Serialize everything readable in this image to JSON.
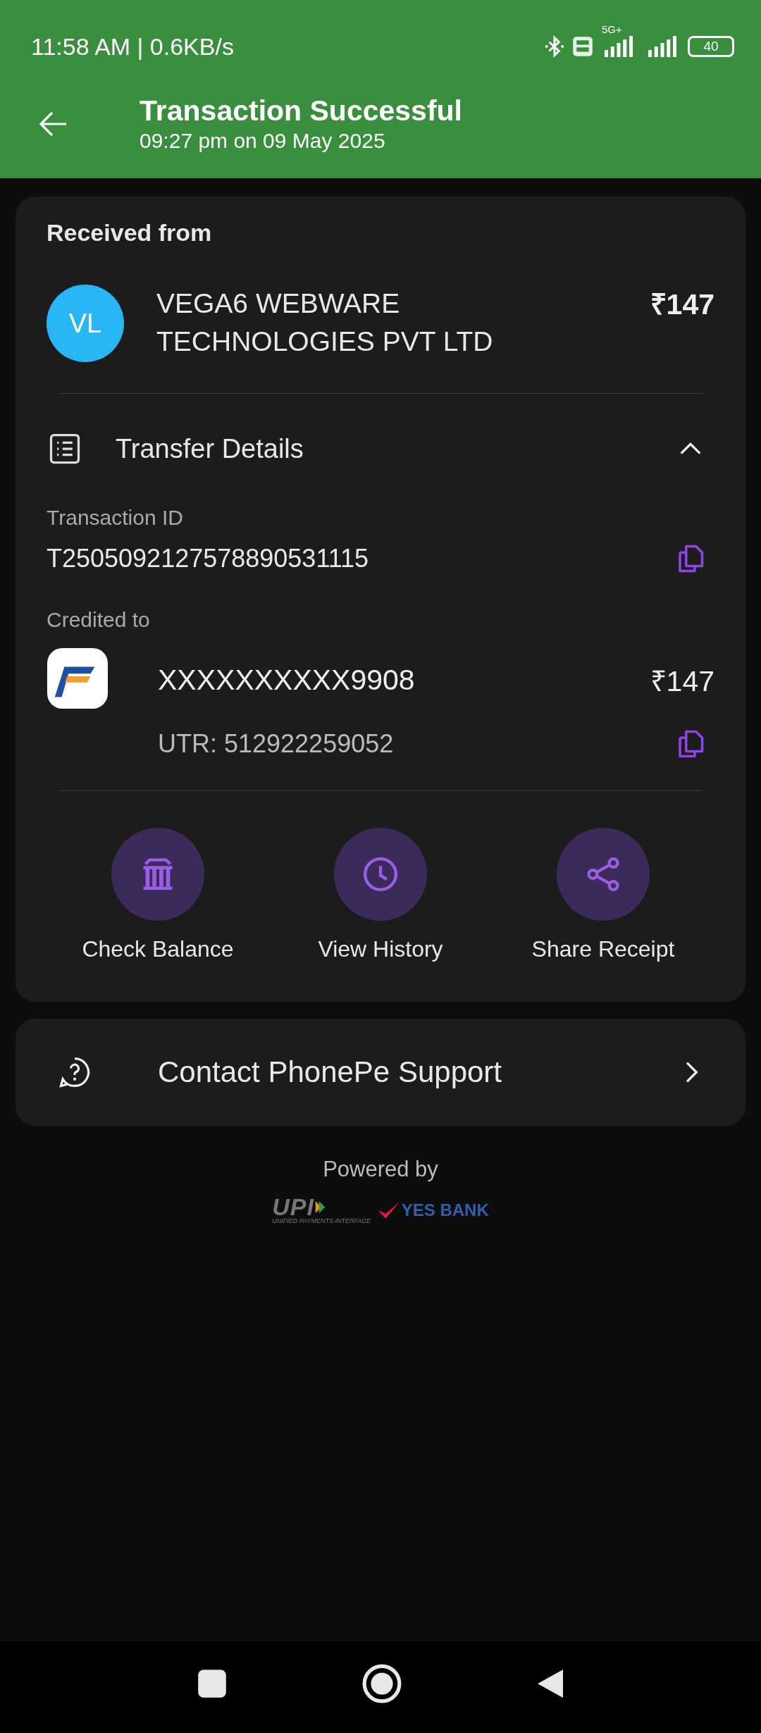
{
  "status_bar": {
    "time": "11:58 AM | 0.6KB/s",
    "network": "5G+",
    "battery": "40"
  },
  "header": {
    "title": "Transaction Successful",
    "subtitle": "09:27 pm on 09 May 2025"
  },
  "received": {
    "heading": "Received from",
    "avatar": "VL",
    "name_lines": [
      "VEGA6 WEBWARE",
      "TECHNOLOGIES PVT LTD"
    ],
    "amount": "₹147"
  },
  "transfer_details": {
    "title": "Transfer Details",
    "expanded": true,
    "transaction_id_label": "Transaction ID",
    "transaction_id": "T2505092127578890531115",
    "credited_label": "Credited to",
    "account": "XXXXXXXXXX9908",
    "account_amount": "₹147",
    "utr": "UTR: 512922259052"
  },
  "actions": [
    {
      "kind": "bank",
      "label": "Check Balance"
    },
    {
      "kind": "history",
      "label": "View History"
    },
    {
      "kind": "share",
      "label": "Share Receipt"
    }
  ],
  "support": {
    "label": "Contact PhonePe Support"
  },
  "footer": {
    "powered_by": "Powered by",
    "upi": "UPI",
    "upi_caption": "UNIFIED PAYMENTS INTERFACE",
    "bank": "YES BANK"
  }
}
